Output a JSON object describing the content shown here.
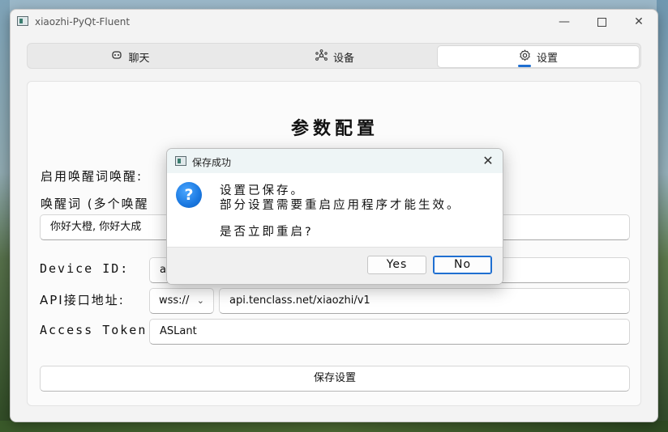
{
  "window": {
    "title": "xiaozhi-PyQt-Fluent"
  },
  "tabs": [
    {
      "label": "聊天",
      "icon": "robot-icon"
    },
    {
      "label": "设备",
      "icon": "network-icon"
    },
    {
      "label": "设置",
      "icon": "gear-icon",
      "active": true
    }
  ],
  "settings": {
    "heading": "参数配置",
    "wake_label": "启用唤醒词唤醒:",
    "wake_words_label": "唤醒词 (多个唤醒",
    "wake_words_value": "你好大橙, 你好大成",
    "device_id_label": "Device ID:",
    "device_id_value": "a4",
    "api_label": "API接口地址:",
    "api_protocol": "wss://",
    "api_url": "api.tenclass.net/xiaozhi/v1",
    "token_label": "Access Token:",
    "token_value": "ASLant",
    "save_button": "保存设置"
  },
  "dialog": {
    "title": "保存成功",
    "line1": "设置已保存。",
    "line2": "部分设置需要重启应用程序才能生效。",
    "question": "是否立即重启?",
    "yes": "Yes",
    "no": "No"
  },
  "colors": {
    "accent": "#1f6fd1",
    "question_icon": "#1a78e0"
  }
}
